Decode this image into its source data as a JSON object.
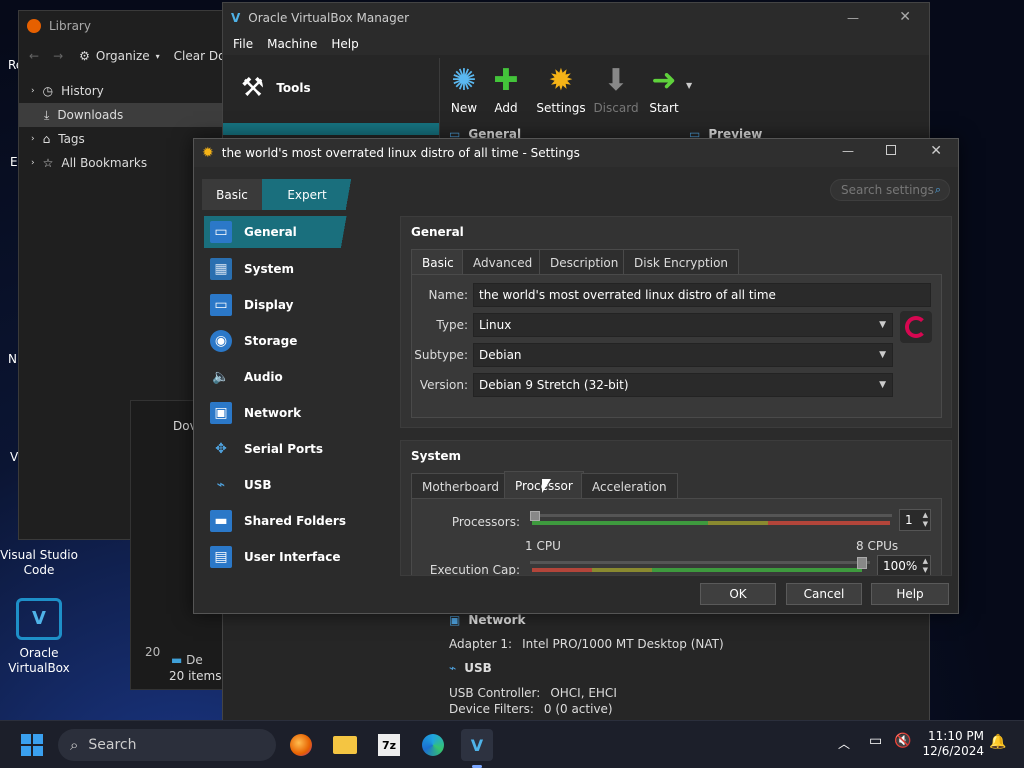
{
  "desktop": {
    "icons": [
      {
        "label": "Visual Studio Code",
        "icon": "vscode-icon"
      },
      {
        "label": "Oracle VirtualBox",
        "icon": "virtualbox-icon"
      }
    ],
    "edge_fragments": [
      "Re",
      "E",
      "N",
      "V"
    ]
  },
  "library": {
    "title": "Library",
    "toolbar": {
      "organize": "Organize",
      "clear": "Clear Dov"
    },
    "tree": [
      "History",
      "Downloads",
      "Tags",
      "All Bookmarks"
    ]
  },
  "downloads_window": {
    "title": "Dov",
    "count": "20",
    "items": "20 items",
    "file": "De"
  },
  "vbox_manager": {
    "title": "Oracle VirtualBox Manager",
    "menu": [
      "File",
      "Machine",
      "Help"
    ],
    "tools_label": "Tools",
    "toolbar": [
      "New",
      "Add",
      "Settings",
      "Discard",
      "Start"
    ],
    "sections": {
      "general": "General",
      "preview": "Preview",
      "network": "Network",
      "usb": "USB"
    },
    "network": {
      "adapter_label": "Adapter 1:",
      "adapter_value": "Intel PRO/1000 MT Desktop (NAT)"
    },
    "usb": {
      "controller_label": "USB Controller:",
      "controller_value": "OHCI, EHCI",
      "filters_label": "Device Filters:",
      "filters_value": "0 (0 active)"
    }
  },
  "settings": {
    "title": "the world's most overrated linux distro of all time - Settings",
    "mode": {
      "basic": "Basic",
      "expert": "Expert"
    },
    "search_placeholder": "Search settings",
    "nav": [
      "General",
      "System",
      "Display",
      "Storage",
      "Audio",
      "Network",
      "Serial Ports",
      "USB",
      "Shared Folders",
      "User Interface"
    ],
    "general": {
      "heading": "General",
      "tabs": [
        "Basic",
        "Advanced",
        "Description",
        "Disk Encryption"
      ],
      "name_label": "Name:",
      "name_value": "the world's most overrated linux distro of all time",
      "type_label": "Type:",
      "type_value": "Linux",
      "subtype_label": "Subtype:",
      "subtype_value": "Debian",
      "version_label": "Version:",
      "version_value": "Debian 9 Stretch (32-bit)"
    },
    "system": {
      "heading": "System",
      "tabs": [
        "Motherboard",
        "Processor",
        "Acceleration"
      ],
      "processors_label": "Processors:",
      "processors_value": "1",
      "cpu_min": "1 CPU",
      "cpu_max": "8 CPUs",
      "exec_label": "Execution Cap:",
      "exec_value": "100%"
    },
    "buttons": {
      "ok": "OK",
      "cancel": "Cancel",
      "help": "Help"
    }
  },
  "taskbar": {
    "search": "Search",
    "time": "11:10 PM",
    "date": "12/6/2024"
  }
}
